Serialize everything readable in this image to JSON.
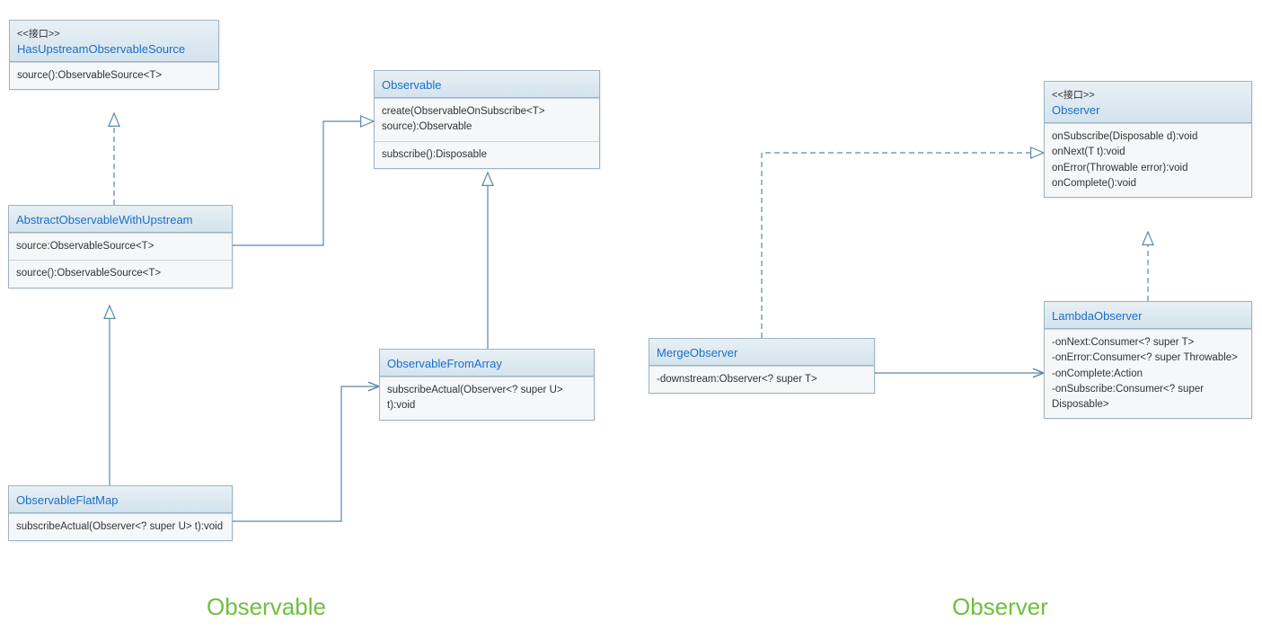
{
  "colors": {
    "link": "#1a6fc9",
    "border": "#9db4c4",
    "headerGradTop": "#e8f0f5",
    "headerGradBot": "#d4e3ed",
    "sectionLabel": "#6fbf3f",
    "connectorSolid": "#5b89a6",
    "connectorDashed": "#5b89a6"
  },
  "stereotype_interface": "<<接口>>",
  "classes": {
    "hasUpstream": {
      "stereotype": "<<接口>>",
      "name": "HasUpstreamObservableSource",
      "ops": [
        "source():ObservableSource<T>"
      ]
    },
    "abstractUpstream": {
      "name": "AbstractObservableWithUpstream",
      "attrs": [
        "source:ObservableSource<T>"
      ],
      "ops": [
        "source():ObservableSource<T>"
      ]
    },
    "observableFlatMap": {
      "name": "ObservableFlatMap",
      "ops": [
        "subscribeActual(Observer<? super U> t):void"
      ]
    },
    "observable": {
      "name": "Observable",
      "ops1": [
        "create(ObservableOnSubscribe<T> source):Observable"
      ],
      "ops2": [
        "subscribe():Disposable"
      ]
    },
    "observableFromArray": {
      "name": "ObservableFromArray",
      "ops": [
        "subscribeActual(Observer<? super U> t):void"
      ]
    },
    "mergeObserver": {
      "name": "MergeObserver",
      "attrs": [
        "-downstream:Observer<? super T>"
      ]
    },
    "observerIface": {
      "stereotype": "<<接口>>",
      "name": "Observer",
      "ops": [
        "onSubscribe(Disposable d):void",
        "onNext(T t):void",
        "onError(Throwable error):void",
        "onComplete():void"
      ]
    },
    "lambdaObserver": {
      "name": "LambdaObserver",
      "attrs": [
        "-onNext:Consumer<? super T>",
        "-onError:Consumer<? super Throwable>",
        "-onComplete:Action",
        "-onSubscribe:Consumer<? super Disposable>"
      ]
    }
  },
  "labels": {
    "observableSection": "Observable",
    "observerSection": "Observer"
  },
  "relationships": [
    {
      "from": "abstractUpstream",
      "to": "hasUpstream",
      "type": "realization"
    },
    {
      "from": "abstractUpstream",
      "to": "observable",
      "type": "generalization"
    },
    {
      "from": "observableFlatMap",
      "to": "abstractUpstream",
      "type": "generalization"
    },
    {
      "from": "observableFromArray",
      "to": "observable",
      "type": "generalization"
    },
    {
      "from": "observableFlatMap",
      "to": "observableFromArray",
      "type": "association"
    },
    {
      "from": "mergeObserver",
      "to": "observerIface",
      "type": "realization"
    },
    {
      "from": "lambdaObserver",
      "to": "observerIface",
      "type": "realization"
    },
    {
      "from": "mergeObserver",
      "to": "lambdaObserver",
      "type": "association"
    }
  ]
}
